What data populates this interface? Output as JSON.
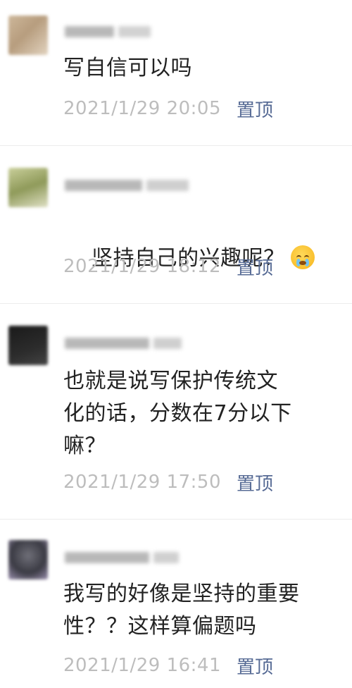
{
  "comments": [
    {
      "text": "写自信可以吗",
      "time": "2021/1/29 20:05",
      "pin_label": "置顶"
    },
    {
      "text": "坚持自己的兴趣呢？",
      "emoji": "crying-face",
      "time": "2021/1/29 18:12",
      "pin_label": "置顶"
    },
    {
      "text": "也就是说写保护传统文\n化的话，分数在7分以下\n嘛？",
      "time": "2021/1/29 17:50",
      "pin_label": "置顶"
    },
    {
      "text": "我写的好像是坚持的重要\n性？？这样算偏题吗",
      "time": "2021/1/29 16:41",
      "pin_label": "置顶"
    }
  ],
  "colors": {
    "pin_link": "#576b95",
    "timestamp": "#bdbdbd",
    "text": "#222222"
  }
}
